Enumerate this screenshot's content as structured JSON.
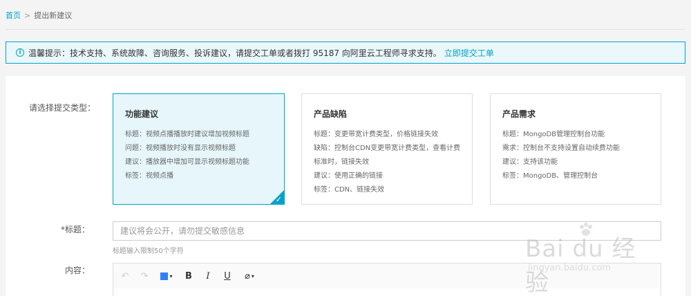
{
  "breadcrumb": {
    "home": "首页",
    "separator": ">",
    "current": "提出新建议"
  },
  "notice": {
    "icon": "info-icon",
    "text": "温馨提示：技术支持、系统故障、咨询服务、投诉建议，请提交工单或者拨打 95187 向阿里云工程师寻求支持。",
    "link": "立即提交工单"
  },
  "form": {
    "type_label": "请选择提交类型：",
    "title_label": "*标题：",
    "title_placeholder": "建议将会公开，请勿提交敏感信息",
    "title_hint": "标题输入限制50个字符",
    "content_label": "内容："
  },
  "cards": [
    {
      "title": "功能建议",
      "lines": [
        "标题：视频点播播放时建议增加视频标题",
        "问题：视频播放时没有显示视频标题",
        "建议：播放器中增加可显示视频标题功能",
        "标签：视频点播"
      ],
      "selected": true
    },
    {
      "title": "产品缺陷",
      "lines": [
        "标题：变更带宽计费类型，价格链接失效",
        "缺陷：控制台CDN变更带宽计费类型，查看计费",
        "标准时，链接失效",
        "建议：使用正确的链接",
        "标签：CDN、链接失效"
      ],
      "selected": false
    },
    {
      "title": "产品需求",
      "lines": [
        "标题：MongoDB管理控制台功能",
        "需求：控制台不支持设置自动续费功能",
        "建议：支持该功能",
        "标签：MongoDB、管理控制台"
      ],
      "selected": false
    }
  ],
  "toolbar": {
    "undo": "↶",
    "redo": "↷",
    "bold": "B",
    "italic": "I",
    "underline": "U",
    "clear": "⌀",
    "caret": "▾",
    "color": "#2f7fff"
  },
  "watermark": {
    "brand": "Bai du 经验",
    "url": "jingyan.baidu.com"
  },
  "colors": {
    "accent": "#00a2ca",
    "selected_bg": "#e6f6fa"
  }
}
